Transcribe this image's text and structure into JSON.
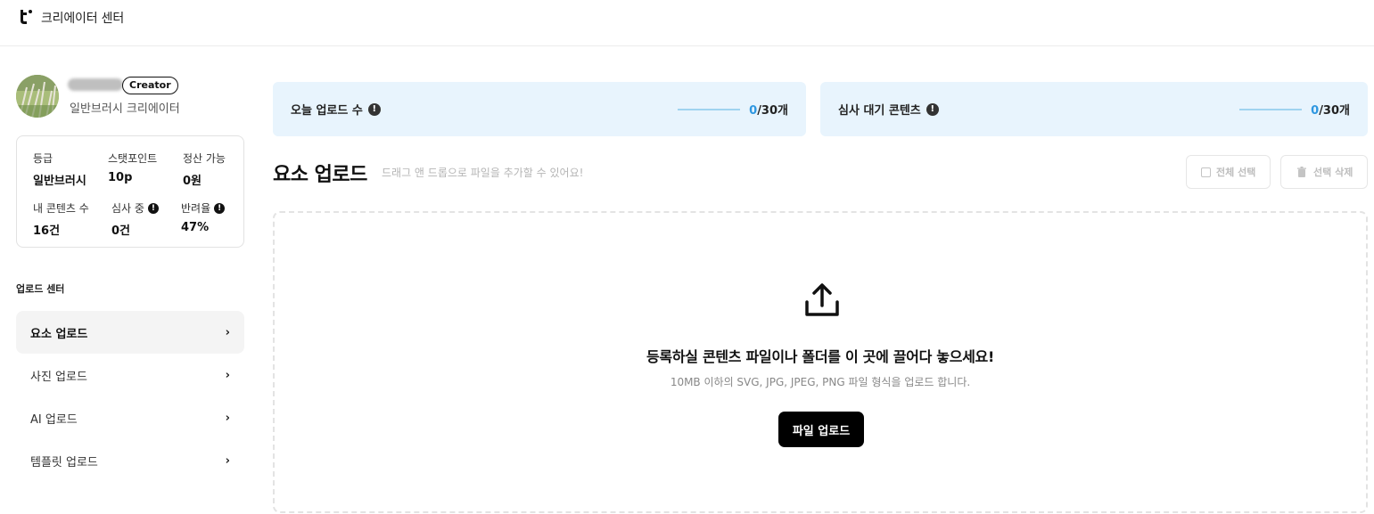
{
  "header": {
    "logo_icon": "tridge-t-logo",
    "title": "크리에이터 센터"
  },
  "profile": {
    "badge": "Creator",
    "subtitle": "일반브러시 크리에이터"
  },
  "stats": {
    "grade_label": "등급",
    "grade_value": "일반브러시",
    "points_label": "스탯포인트",
    "points_value": "10p",
    "settle_label": "정산 가능",
    "settle_value": "0원",
    "content_label": "내 콘텐츠 수",
    "content_value": "16건",
    "review_label": "심사 중",
    "review_value": "0건",
    "reject_label": "반려율",
    "reject_value": "47%"
  },
  "nav": {
    "heading": "업로드 센터",
    "items": [
      {
        "label": "요소 업로드",
        "active": true
      },
      {
        "label": "사진 업로드",
        "active": false
      },
      {
        "label": "AI 업로드",
        "active": false
      },
      {
        "label": "템플릿 업로드",
        "active": false
      }
    ]
  },
  "summary": {
    "today_label": "오늘 업로드 수",
    "today_current": "0",
    "today_total": "/30개",
    "pending_label": "심사 대기 콘텐츠",
    "pending_current": "0",
    "pending_total": "/30개"
  },
  "upload": {
    "title": "요소 업로드",
    "hint": "드래그 앤 드롭으로 파일을 추가할 수 있어요!",
    "select_all": "전체 선택",
    "delete_selected": "선택 삭제",
    "drop_title": "등록하실 콘텐츠 파일이나 폴더를 이 곳에 끌어다 놓으세요!",
    "drop_sub": "10MB 이하의 SVG, JPG, JPEG, PNG 파일 형식을 업로드 합니다.",
    "button": "파일 업로드"
  },
  "colors": {
    "accent": "#2f97e0",
    "summary_bg": "#e8f4fd"
  }
}
